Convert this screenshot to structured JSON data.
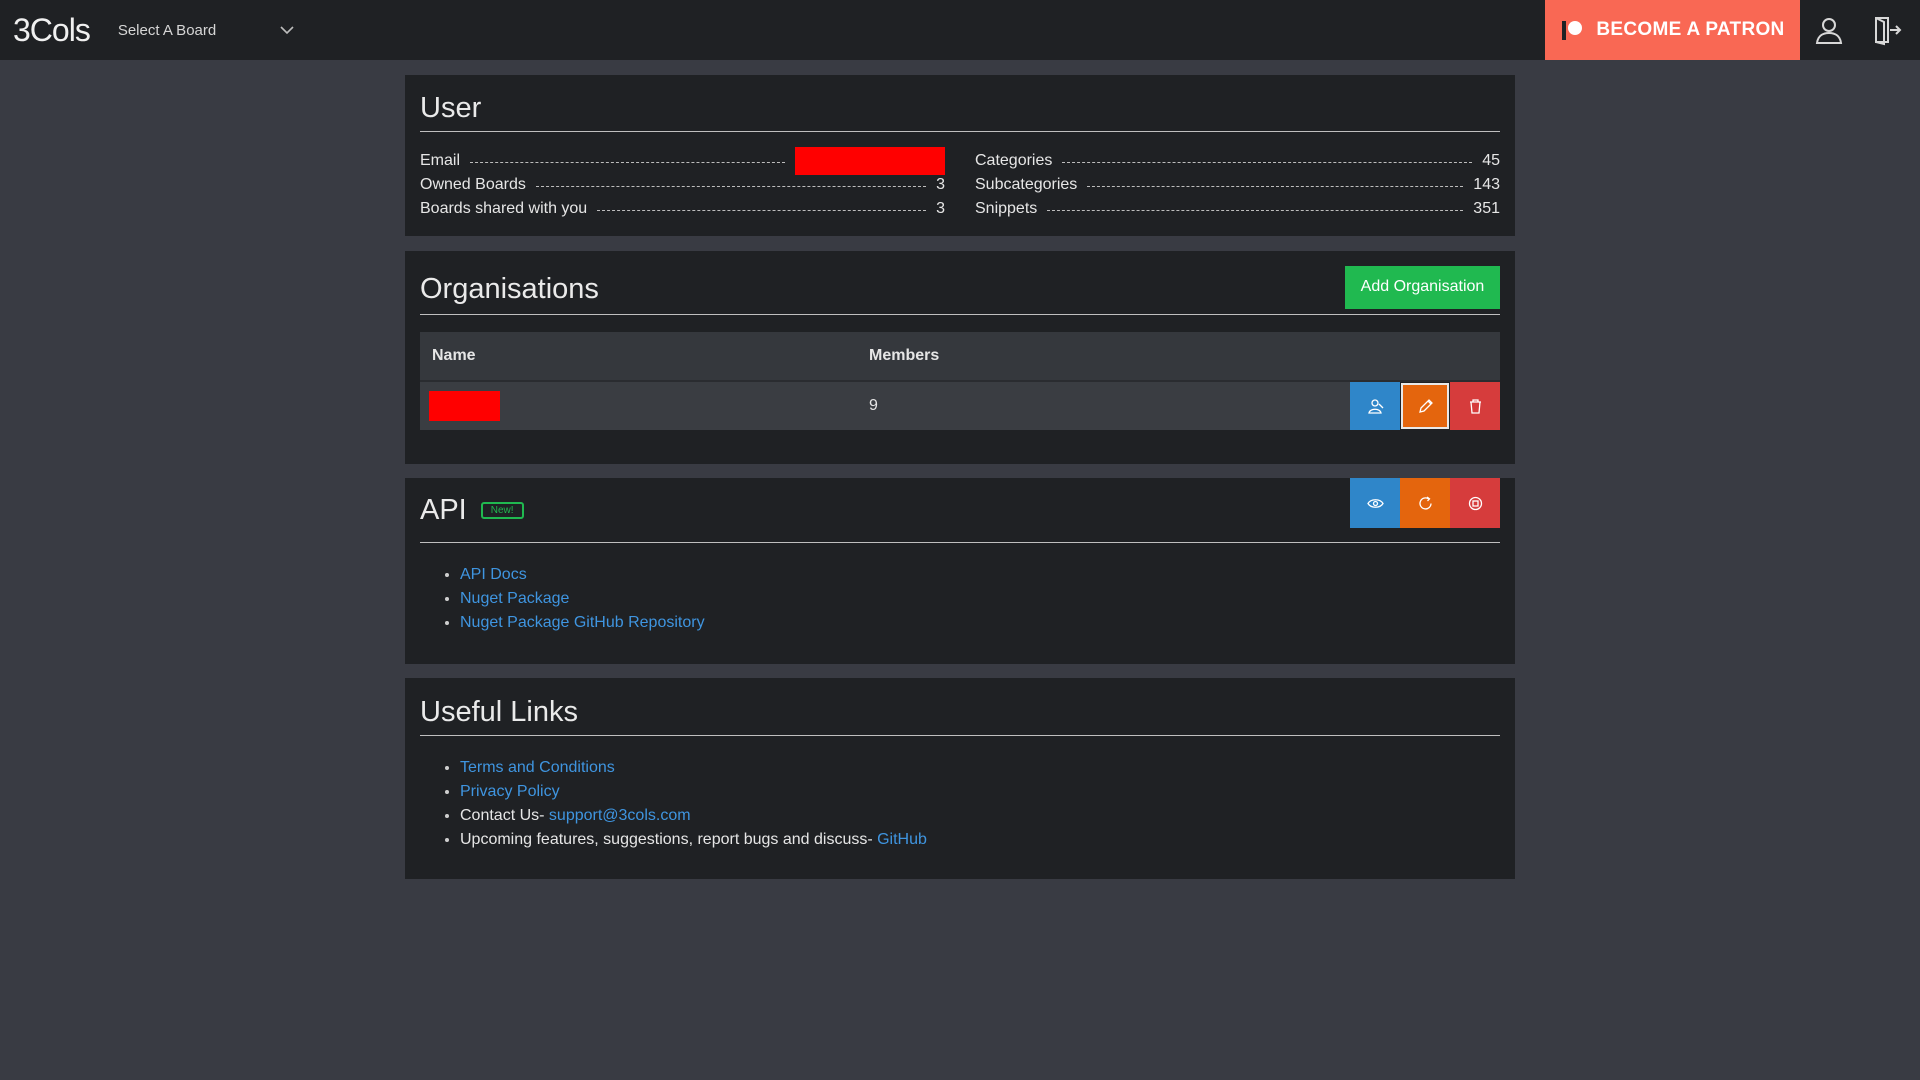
{
  "topbar": {
    "brand": "3Cols",
    "board_select": "Select A Board",
    "patron_label": "BECOME A PATRON",
    "icons": [
      "chevron-down-icon",
      "patreon-logo-icon",
      "user-icon",
      "logout-icon"
    ]
  },
  "user": {
    "title": "User",
    "left": [
      {
        "label": "Email",
        "value": ""
      },
      {
        "label": "Owned Boards",
        "value": "3"
      },
      {
        "label": "Boards shared with you",
        "value": "3"
      }
    ],
    "right": [
      {
        "label": "Categories",
        "value": "45"
      },
      {
        "label": "Subcategories",
        "value": "143"
      },
      {
        "label": "Snippets",
        "value": "351"
      }
    ]
  },
  "organisations": {
    "title": "Organisations",
    "add_label": "Add Organisation",
    "columns": [
      "Name",
      "Members"
    ],
    "rows": [
      {
        "name": "",
        "members": "9"
      }
    ]
  },
  "api": {
    "title": "API",
    "badge": "New!",
    "links": [
      "API Docs",
      "Nuget Package",
      "Nuget Package GitHub Repository"
    ]
  },
  "useful": {
    "title": "Useful Links",
    "terms": "Terms and Conditions",
    "privacy": "Privacy Policy",
    "contact_prefix": "Contact Us- ",
    "contact_email": "support@3cols.com",
    "upcoming_prefix": "Upcoming features, suggestions, report bugs and discuss- ",
    "github": "GitHub"
  },
  "colors": {
    "background": "#393b43",
    "panel": "#1f2124",
    "patron": "#f96854",
    "green": "#20b950",
    "blue": "#2f86c9",
    "orange": "#e4650d",
    "red": "#d63c3c",
    "link": "#3f95e0",
    "redaction": "#ff0000"
  }
}
